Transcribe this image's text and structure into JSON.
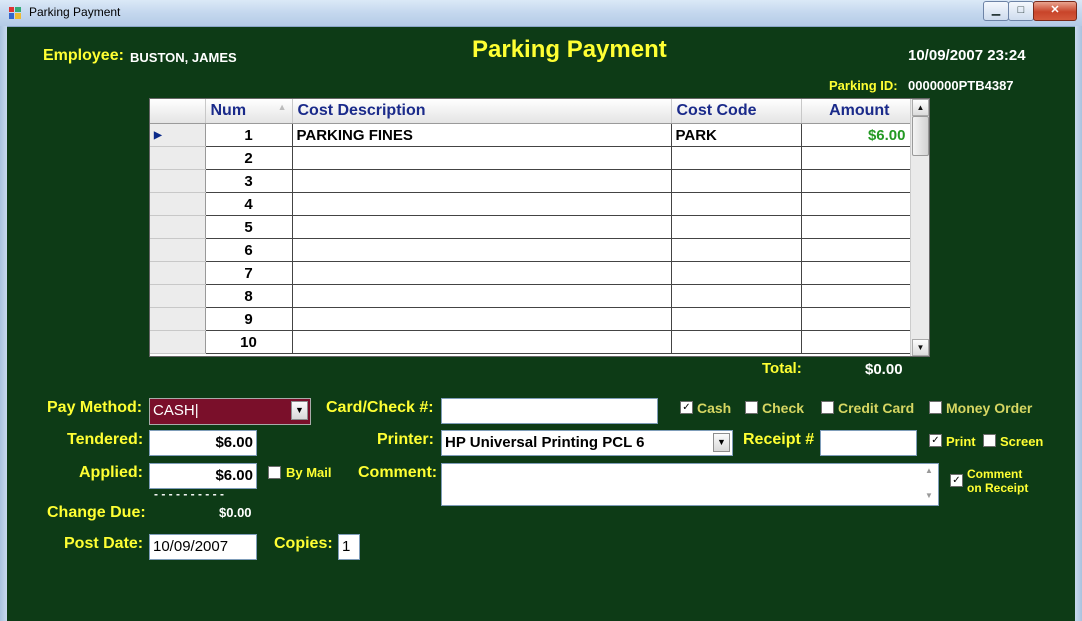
{
  "window": {
    "title": "Parking Payment"
  },
  "header": {
    "employee_label": "Employee:",
    "employee_name": "BUSTON, JAMES",
    "form_title": "Parking Payment",
    "datetime": "10/09/2007 23:24",
    "parking_id_label": "Parking ID:",
    "parking_id": "0000000PTB4387"
  },
  "grid": {
    "columns": [
      "Num",
      "Cost Description",
      "Cost Code",
      "Amount"
    ],
    "rows": [
      {
        "num": "1",
        "desc": "PARKING FINES",
        "code": "PARK",
        "amount": "$6.00"
      },
      {
        "num": "2",
        "desc": "",
        "code": "",
        "amount": ""
      },
      {
        "num": "3",
        "desc": "",
        "code": "",
        "amount": ""
      },
      {
        "num": "4",
        "desc": "",
        "code": "",
        "amount": ""
      },
      {
        "num": "5",
        "desc": "",
        "code": "",
        "amount": ""
      },
      {
        "num": "6",
        "desc": "",
        "code": "",
        "amount": ""
      },
      {
        "num": "7",
        "desc": "",
        "code": "",
        "amount": ""
      },
      {
        "num": "8",
        "desc": "",
        "code": "",
        "amount": ""
      },
      {
        "num": "9",
        "desc": "",
        "code": "",
        "amount": ""
      },
      {
        "num": "10",
        "desc": "",
        "code": "",
        "amount": ""
      }
    ],
    "total_label": "Total:",
    "total_value": "$0.00"
  },
  "payment": {
    "pay_method_label": "Pay Method:",
    "pay_method_value": "CASH",
    "tendered_label": "Tendered:",
    "tendered_value": "$6.00",
    "applied_label": "Applied:",
    "applied_value": "$6.00",
    "by_mail_label": "By Mail",
    "dashes": "- - - - - - - - - -",
    "change_due_label": "Change Due:",
    "change_due_value": "$0.00",
    "post_date_label": "Post Date:",
    "post_date_value": "10/09/2007",
    "copies_label": "Copies:",
    "copies_value": "1",
    "card_check_label": "Card/Check #:",
    "card_check_value": "",
    "printer_label": "Printer:",
    "printer_value": "HP Universal Printing PCL 6",
    "comment_label": "Comment:",
    "comment_value": "",
    "receipt_label": "Receipt #",
    "receipt_value": ""
  },
  "checkboxes": {
    "cash": {
      "label": "Cash",
      "checked": true
    },
    "check": {
      "label": "Check",
      "checked": false
    },
    "credit_card": {
      "label": "Credit Card",
      "checked": false
    },
    "money_order": {
      "label": "Money Order",
      "checked": false
    },
    "print": {
      "label": "Print",
      "checked": true
    },
    "screen": {
      "label": "Screen",
      "checked": false
    },
    "comment_receipt_line1": "Comment",
    "comment_receipt_line2": "on Receipt",
    "comment_on_receipt_checked": true
  },
  "colors": {
    "background": "#0d3b16",
    "label_yellow": "#ffff33",
    "pay_method_bg": "#7a0f2a",
    "amount_green": "#229922"
  }
}
